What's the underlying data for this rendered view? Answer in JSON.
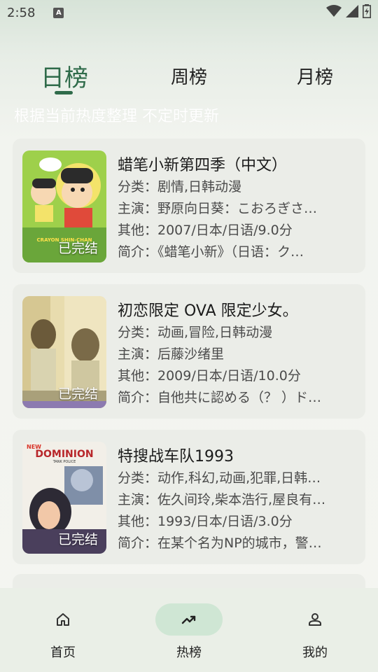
{
  "status": {
    "time": "2:58",
    "indicator": "A"
  },
  "tabs": [
    {
      "label": "日榜",
      "active": true
    },
    {
      "label": "周榜",
      "active": false
    },
    {
      "label": "月榜",
      "active": false
    }
  ],
  "subtitle": "根据当前热度整理 不定时更新",
  "items": [
    {
      "title": "蜡笔小新第四季（中文）",
      "badge": "已完结",
      "category": "分类：剧情,日韩动漫",
      "cast": "主演：野原向日葵：こおろぎさ…",
      "other": "其他：2007/日本/日语/9.0分",
      "intro": "简介：《蜡笔小新》（日语：ク…",
      "poster_logo": "CRAYON SHIN-CHAN"
    },
    {
      "title": "初恋限定 OVA 限定少女。",
      "badge": "已完结",
      "category": "分类：动画,冒险,日韩动漫",
      "cast": "主演：后藤沙绪里",
      "other": "其他：2009/日本/日语/10.0分",
      "intro": "简介：自他共に認める（？ ）ド…"
    },
    {
      "title": "特搜战车队1993",
      "badge": "已完结",
      "category": "分类：动作,科幻,动画,犯罪,日韩…",
      "cast": "主演：佐久间玲,柴本浩行,屋良有…",
      "other": "其他：1993/日本/日语/3.0分",
      "intro": "简介：在某个名为NP的城市，警…",
      "poster_logo_top": "NEW",
      "poster_logo": "DOMINION",
      "poster_logo_sub": "TANK POLICE"
    }
  ],
  "nav": [
    {
      "label": "首页",
      "icon": "home-icon",
      "active": false
    },
    {
      "label": "热榜",
      "icon": "trending-icon",
      "active": true
    },
    {
      "label": "我的",
      "icon": "person-icon",
      "active": false
    }
  ],
  "colors": {
    "accent": "#2f6b4a",
    "card": "#ebede8",
    "nav_pill": "#cfe6d4"
  }
}
